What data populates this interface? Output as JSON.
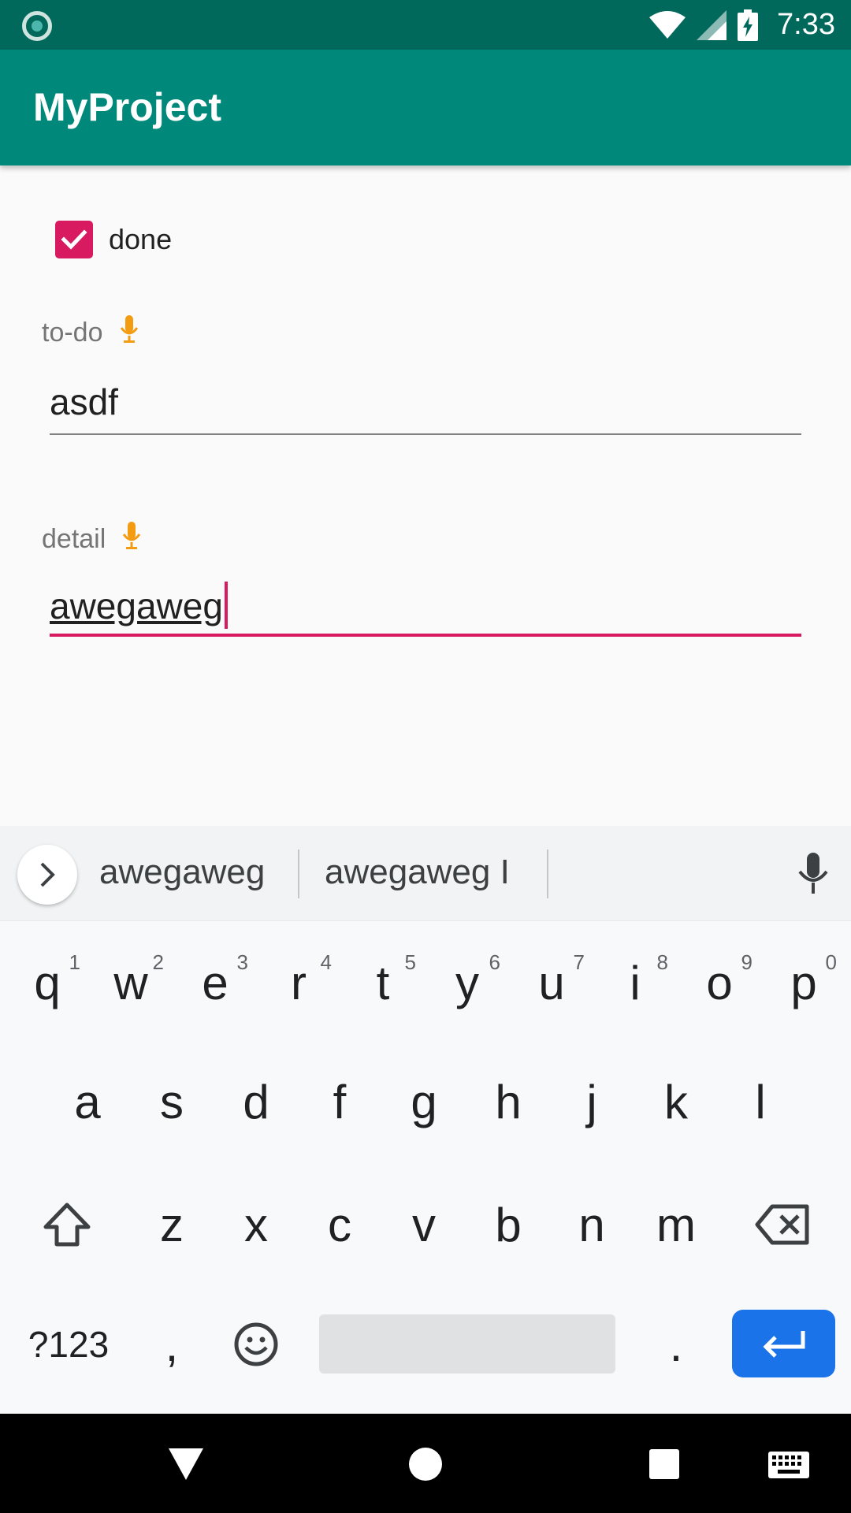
{
  "status_bar": {
    "time": "7:33",
    "left_icon": "notification-circle-icon",
    "icons": [
      "wifi-icon",
      "signal-icon",
      "battery-charging-icon"
    ],
    "background": "#00695c"
  },
  "app_bar": {
    "title": "MyProject",
    "background": "#00897b"
  },
  "form": {
    "checkbox": {
      "label": "done",
      "checked": true,
      "color": "#d81b60"
    },
    "todo": {
      "label": "to-do",
      "value": "asdf",
      "icon": "mic-icon"
    },
    "detail": {
      "label": "detail",
      "value": "awegaweg",
      "icon": "mic-icon",
      "focused": true,
      "accent": "#d81b60"
    }
  },
  "keyboard": {
    "suggestions": [
      "awegaweg",
      "awegaweg I"
    ],
    "row1": [
      {
        "key": "q",
        "hint": "1"
      },
      {
        "key": "w",
        "hint": "2"
      },
      {
        "key": "e",
        "hint": "3"
      },
      {
        "key": "r",
        "hint": "4"
      },
      {
        "key": "t",
        "hint": "5"
      },
      {
        "key": "y",
        "hint": "6"
      },
      {
        "key": "u",
        "hint": "7"
      },
      {
        "key": "i",
        "hint": "8"
      },
      {
        "key": "o",
        "hint": "9"
      },
      {
        "key": "p",
        "hint": "0"
      }
    ],
    "row2": [
      "a",
      "s",
      "d",
      "f",
      "g",
      "h",
      "j",
      "k",
      "l"
    ],
    "row3": [
      "z",
      "x",
      "c",
      "v",
      "b",
      "n",
      "m"
    ],
    "symbols_label": "?123",
    "comma": ",",
    "period": ".",
    "shift_icon": "shift-icon",
    "backspace_icon": "backspace-icon",
    "emoji_icon": "emoji-icon",
    "enter_icon": "enter-icon",
    "enter_color": "#1a73e8"
  },
  "nav_bar": {
    "icons": [
      "back-icon",
      "home-icon",
      "recents-icon",
      "keyboard-switch-icon"
    ]
  }
}
